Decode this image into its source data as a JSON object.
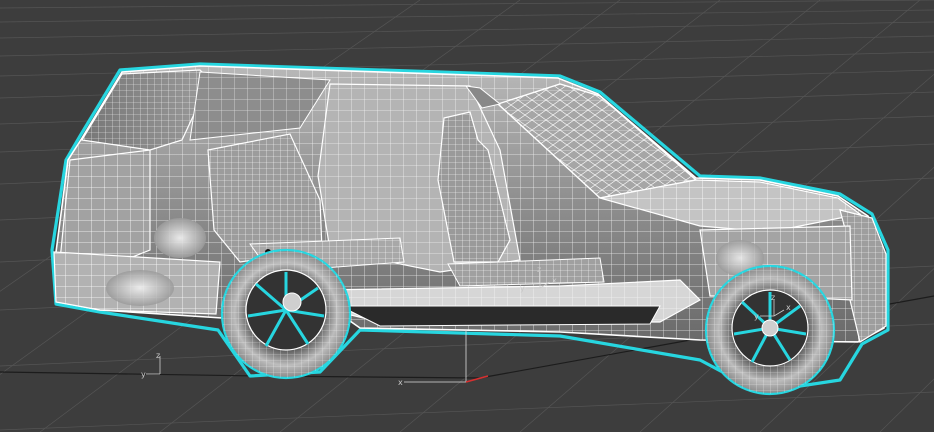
{
  "viewport": {
    "kind": "3d-modeling-viewport",
    "display_mode": "wireframe-on-shaded",
    "selection_outline_color": "#27d6e0",
    "wire_color": "#ffffff",
    "background_color": "#3d3d3d",
    "grid_color": "#555555",
    "model": "suv-car-cutaway",
    "gizmo_labels": {
      "x": "x",
      "y": "y",
      "z": "z"
    }
  }
}
